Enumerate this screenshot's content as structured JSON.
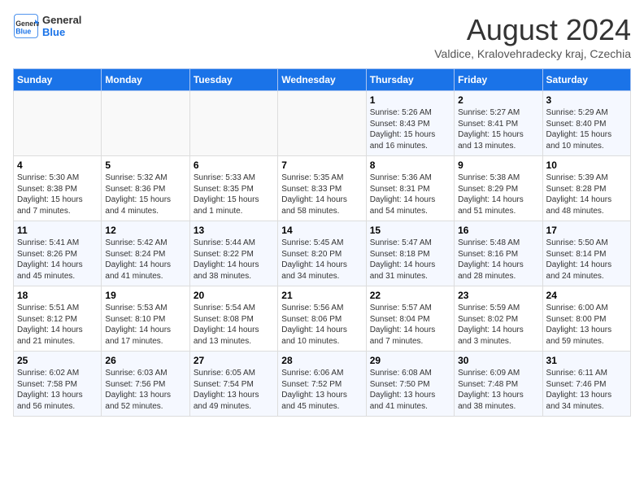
{
  "logo": {
    "line1": "General",
    "line2": "Blue"
  },
  "title": "August 2024",
  "location": "Valdice, Kralovehradecky kraj, Czechia",
  "days_of_week": [
    "Sunday",
    "Monday",
    "Tuesday",
    "Wednesday",
    "Thursday",
    "Friday",
    "Saturday"
  ],
  "weeks": [
    [
      {
        "day": "",
        "info": ""
      },
      {
        "day": "",
        "info": ""
      },
      {
        "day": "",
        "info": ""
      },
      {
        "day": "",
        "info": ""
      },
      {
        "day": "1",
        "info": "Sunrise: 5:26 AM\nSunset: 8:43 PM\nDaylight: 15 hours\nand 16 minutes."
      },
      {
        "day": "2",
        "info": "Sunrise: 5:27 AM\nSunset: 8:41 PM\nDaylight: 15 hours\nand 13 minutes."
      },
      {
        "day": "3",
        "info": "Sunrise: 5:29 AM\nSunset: 8:40 PM\nDaylight: 15 hours\nand 10 minutes."
      }
    ],
    [
      {
        "day": "4",
        "info": "Sunrise: 5:30 AM\nSunset: 8:38 PM\nDaylight: 15 hours\nand 7 minutes."
      },
      {
        "day": "5",
        "info": "Sunrise: 5:32 AM\nSunset: 8:36 PM\nDaylight: 15 hours\nand 4 minutes."
      },
      {
        "day": "6",
        "info": "Sunrise: 5:33 AM\nSunset: 8:35 PM\nDaylight: 15 hours\nand 1 minute."
      },
      {
        "day": "7",
        "info": "Sunrise: 5:35 AM\nSunset: 8:33 PM\nDaylight: 14 hours\nand 58 minutes."
      },
      {
        "day": "8",
        "info": "Sunrise: 5:36 AM\nSunset: 8:31 PM\nDaylight: 14 hours\nand 54 minutes."
      },
      {
        "day": "9",
        "info": "Sunrise: 5:38 AM\nSunset: 8:29 PM\nDaylight: 14 hours\nand 51 minutes."
      },
      {
        "day": "10",
        "info": "Sunrise: 5:39 AM\nSunset: 8:28 PM\nDaylight: 14 hours\nand 48 minutes."
      }
    ],
    [
      {
        "day": "11",
        "info": "Sunrise: 5:41 AM\nSunset: 8:26 PM\nDaylight: 14 hours\nand 45 minutes."
      },
      {
        "day": "12",
        "info": "Sunrise: 5:42 AM\nSunset: 8:24 PM\nDaylight: 14 hours\nand 41 minutes."
      },
      {
        "day": "13",
        "info": "Sunrise: 5:44 AM\nSunset: 8:22 PM\nDaylight: 14 hours\nand 38 minutes."
      },
      {
        "day": "14",
        "info": "Sunrise: 5:45 AM\nSunset: 8:20 PM\nDaylight: 14 hours\nand 34 minutes."
      },
      {
        "day": "15",
        "info": "Sunrise: 5:47 AM\nSunset: 8:18 PM\nDaylight: 14 hours\nand 31 minutes."
      },
      {
        "day": "16",
        "info": "Sunrise: 5:48 AM\nSunset: 8:16 PM\nDaylight: 14 hours\nand 28 minutes."
      },
      {
        "day": "17",
        "info": "Sunrise: 5:50 AM\nSunset: 8:14 PM\nDaylight: 14 hours\nand 24 minutes."
      }
    ],
    [
      {
        "day": "18",
        "info": "Sunrise: 5:51 AM\nSunset: 8:12 PM\nDaylight: 14 hours\nand 21 minutes."
      },
      {
        "day": "19",
        "info": "Sunrise: 5:53 AM\nSunset: 8:10 PM\nDaylight: 14 hours\nand 17 minutes."
      },
      {
        "day": "20",
        "info": "Sunrise: 5:54 AM\nSunset: 8:08 PM\nDaylight: 14 hours\nand 13 minutes."
      },
      {
        "day": "21",
        "info": "Sunrise: 5:56 AM\nSunset: 8:06 PM\nDaylight: 14 hours\nand 10 minutes."
      },
      {
        "day": "22",
        "info": "Sunrise: 5:57 AM\nSunset: 8:04 PM\nDaylight: 14 hours\nand 7 minutes."
      },
      {
        "day": "23",
        "info": "Sunrise: 5:59 AM\nSunset: 8:02 PM\nDaylight: 14 hours\nand 3 minutes."
      },
      {
        "day": "24",
        "info": "Sunrise: 6:00 AM\nSunset: 8:00 PM\nDaylight: 13 hours\nand 59 minutes."
      }
    ],
    [
      {
        "day": "25",
        "info": "Sunrise: 6:02 AM\nSunset: 7:58 PM\nDaylight: 13 hours\nand 56 minutes."
      },
      {
        "day": "26",
        "info": "Sunrise: 6:03 AM\nSunset: 7:56 PM\nDaylight: 13 hours\nand 52 minutes."
      },
      {
        "day": "27",
        "info": "Sunrise: 6:05 AM\nSunset: 7:54 PM\nDaylight: 13 hours\nand 49 minutes."
      },
      {
        "day": "28",
        "info": "Sunrise: 6:06 AM\nSunset: 7:52 PM\nDaylight: 13 hours\nand 45 minutes."
      },
      {
        "day": "29",
        "info": "Sunrise: 6:08 AM\nSunset: 7:50 PM\nDaylight: 13 hours\nand 41 minutes."
      },
      {
        "day": "30",
        "info": "Sunrise: 6:09 AM\nSunset: 7:48 PM\nDaylight: 13 hours\nand 38 minutes."
      },
      {
        "day": "31",
        "info": "Sunrise: 6:11 AM\nSunset: 7:46 PM\nDaylight: 13 hours\nand 34 minutes."
      }
    ]
  ]
}
